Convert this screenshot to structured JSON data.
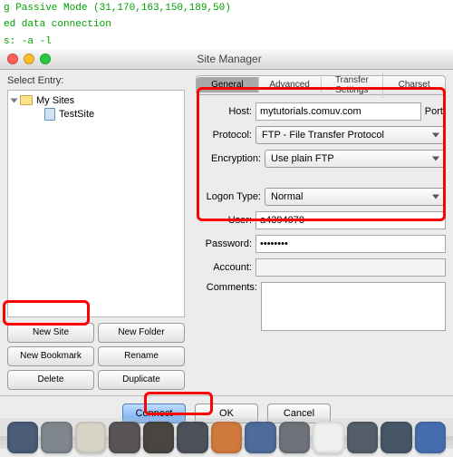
{
  "terminal": {
    "line1": "g Passive Mode (31,170,163,150,189,50)",
    "line2": "ed data connection",
    "line3": "s: -a -l"
  },
  "window": {
    "title": "Site Manager"
  },
  "sidebar": {
    "label": "Select Entry:",
    "root": "My Sites",
    "child": "TestSite"
  },
  "buttons_left": {
    "new_site": "New Site",
    "new_folder": "New Folder",
    "new_bookmark": "New Bookmark",
    "rename": "Rename",
    "delete": "Delete",
    "duplicate": "Duplicate"
  },
  "tabs": {
    "general": "General",
    "advanced": "Advanced",
    "transfer": "Transfer Settings",
    "charset": "Charset"
  },
  "form": {
    "host_label": "Host:",
    "host_value": "mytutorials.comuv.com",
    "port_label": "Port:",
    "port_value": "",
    "protocol_label": "Protocol:",
    "protocol_value": "FTP - File Transfer Protocol",
    "encryption_label": "Encryption:",
    "encryption_value": "Use plain FTP",
    "logon_label": "Logon Type:",
    "logon_value": "Normal",
    "user_label": "User:",
    "user_value": "a4394078",
    "password_label": "Password:",
    "password_value": "••••••••",
    "account_label": "Account:",
    "account_value": "",
    "comments_label": "Comments:"
  },
  "bottom": {
    "connect": "Connect",
    "ok": "OK",
    "cancel": "Cancel"
  },
  "dock_colors": [
    "#4a5c78",
    "#7f868c",
    "#d8d5c8",
    "#585458",
    "#4a4540",
    "#4d525a",
    "#d07a3e",
    "#4e6b9a",
    "#6d7378",
    "#f0f0f0",
    "#545d6a",
    "#475667",
    "#466eae"
  ]
}
